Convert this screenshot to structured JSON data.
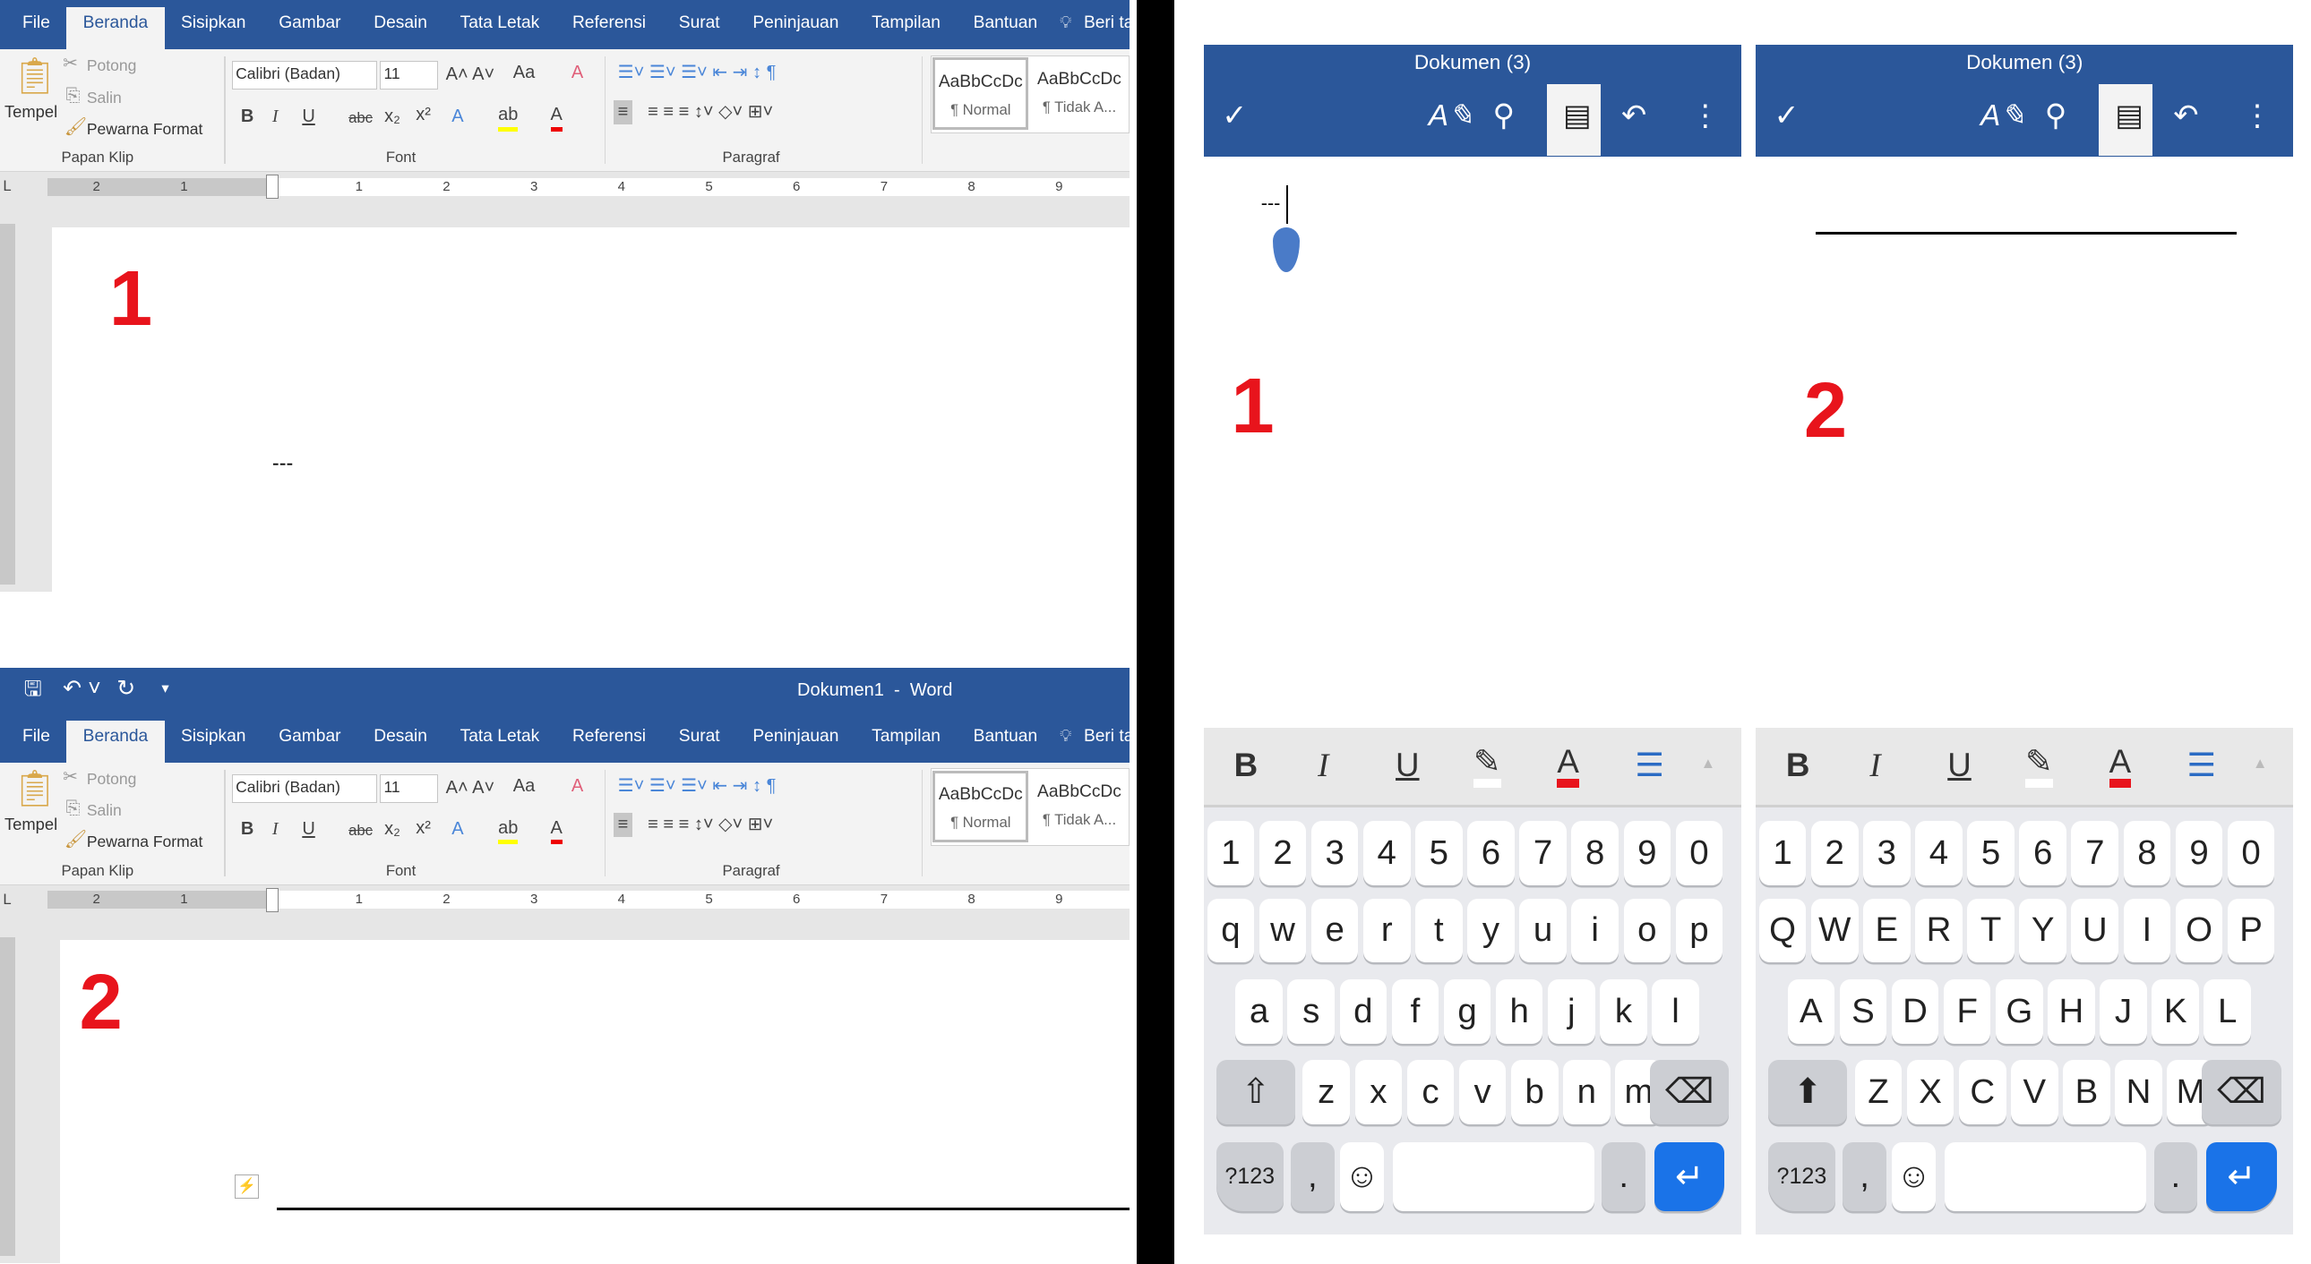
{
  "word": {
    "title": "Dokumen1  -  Word",
    "tabs": [
      "File",
      "Beranda",
      "Sisipkan",
      "Gambar",
      "Desain",
      "Tata Letak",
      "Referensi",
      "Surat",
      "Peninjauan",
      "Tampilan",
      "Bantuan"
    ],
    "tell_me": "Beri tahu",
    "clipboard": {
      "paste": "Tempel",
      "cut": "Potong",
      "copy": "Salin",
      "format_painter": "Pewarna Format",
      "group": "Papan Klip"
    },
    "font": {
      "name": "Calibri (Badan)",
      "size": "11",
      "group": "Font",
      "bold": "B",
      "italic": "I",
      "underline": "U",
      "strike": "abc",
      "change_case": "Aa"
    },
    "paragraph": {
      "group": "Paragraf"
    },
    "styles": [
      {
        "preview": "AaBbCcDc",
        "name": "¶ Normal"
      },
      {
        "preview": "AaBbCcDc",
        "name": "¶ Tidak A..."
      }
    ],
    "ruler_ticks": [
      "2",
      "1",
      "",
      "1",
      "2",
      "3",
      "4",
      "5",
      "6",
      "7",
      "8",
      "9"
    ],
    "doc1_text": "---",
    "label1": "1",
    "label2": "2"
  },
  "phone": {
    "title": "Dokumen (3)",
    "doc1_text": "---",
    "label1": "1",
    "label2": "2",
    "format": {
      "bold": "B",
      "italic": "I",
      "underline": "U"
    },
    "accent": "#2b579a",
    "font_color": "#e8141c",
    "keys_lower": [
      [
        "1",
        "2",
        "3",
        "4",
        "5",
        "6",
        "7",
        "8",
        "9",
        "0"
      ],
      [
        "q",
        "w",
        "e",
        "r",
        "t",
        "y",
        "u",
        "i",
        "o",
        "p"
      ],
      [
        "a",
        "s",
        "d",
        "f",
        "g",
        "h",
        "j",
        "k",
        "l"
      ],
      [
        "z",
        "x",
        "c",
        "v",
        "b",
        "n",
        "m"
      ]
    ],
    "keys_upper": [
      [
        "1",
        "2",
        "3",
        "4",
        "5",
        "6",
        "7",
        "8",
        "9",
        "0"
      ],
      [
        "Q",
        "W",
        "E",
        "R",
        "T",
        "Y",
        "U",
        "I",
        "O",
        "P"
      ],
      [
        "A",
        "S",
        "D",
        "F",
        "G",
        "H",
        "J",
        "K",
        "L"
      ],
      [
        "Z",
        "X",
        "C",
        "V",
        "B",
        "N",
        "M"
      ]
    ],
    "symbols_key": "?123",
    "comma": ",",
    "period": "."
  }
}
